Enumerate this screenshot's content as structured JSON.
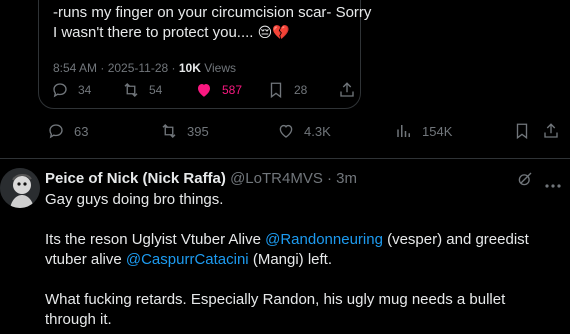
{
  "quote": {
    "line1": "-runs my finger on your circumcision scar- Sorry",
    "line2": "I wasn't there to protect you....",
    "emoji": "😔💔",
    "meta_time": "8:54 AM · 2025-11-28 · ",
    "meta_views_count": "10K",
    "meta_views_label": " Views",
    "actions": {
      "replies": "34",
      "reposts": "54",
      "likes": "587",
      "bookmarks": "28"
    }
  },
  "main_actions": {
    "replies": "63",
    "reposts": "395",
    "likes": "4.3K",
    "views": "154K"
  },
  "reply": {
    "display_name": "Peice of Nick (Nick Raffa)",
    "handle_time": " @LoTR4MVS · 3m",
    "line1": "Gay guys doing bro things.",
    "p2_before": "Its the reson Uglyist Vtuber Alive ",
    "mention1": "@Randonneuring",
    "p2_mid": " (vesper) and greedist vtuber alive ",
    "mention2": "@CaspurrCatacini",
    "p2_after": " (Mangi) left.",
    "p3": "What fucking retards. Especially Randon, his ugly mug needs a bullet through it."
  },
  "colors": {
    "accent": "#1d9bf0",
    "like": "#f91880",
    "muted": "#71767b",
    "text": "#e7e9ea",
    "border": "#2f3336"
  },
  "icons": [
    "reply-icon",
    "repost-icon",
    "heart-icon",
    "bookmark-icon",
    "share-icon",
    "views-icon",
    "grok-icon",
    "more-icon"
  ]
}
